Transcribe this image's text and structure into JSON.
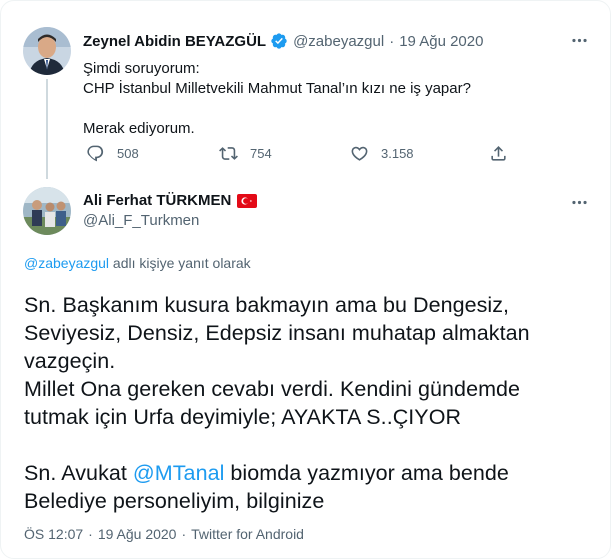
{
  "parent_tweet": {
    "author_name": "Zeynel Abidin BEYAZGÜL",
    "handle": "@zabeyazgul",
    "date": "19 Ağu 2020",
    "lines": [
      "Şimdi soruyorum:",
      "CHP İstanbul Milletvekili Mahmut Tanal’ın kızı ne iş yapar?",
      "",
      "Merak ediyorum."
    ],
    "reply_count": "508",
    "retweet_count": "754",
    "like_count": "3.158"
  },
  "main_tweet": {
    "author_name": "Ali Ferhat TÜRKMEN",
    "handle": "@Ali_F_Turkmen",
    "reply_to_handle": "@zabeyazgul",
    "reply_to_suffix": " adlı kişiye yanıt olarak",
    "lines": [
      "Sn. Başkanım kusura bakmayın ama bu Dengesiz,",
      "Seviyesiz, Densiz, Edepsiz insanı muhatap almaktan",
      "vazgeçin.",
      "Millet Ona gereken cevabı verdi. Kendini gündemde",
      "tutmak için Urfa deyimiyle; AYAKTA S..ÇIYOR",
      ""
    ],
    "line7_before": "Sn. Avukat ",
    "line7_mention": "@MTanal",
    "line7_after": " biomda yazmıyor ama bende",
    "line8": "Belediye personeliyim, bilginize",
    "time": "ÖS 12:07",
    "date": "19 Ağu 2020",
    "source": "Twitter for Android"
  },
  "colors": {
    "link": "#1d9bf0",
    "muted": "#536471",
    "verified": "#1d9bf0",
    "flag": "#e30a17"
  },
  "icons": {
    "verified": "verified-badge-icon",
    "more": "more-icon",
    "reply": "reply-icon",
    "retweet": "retweet-icon",
    "like": "like-icon",
    "share": "share-icon",
    "flag": "turkey-flag-icon"
  }
}
